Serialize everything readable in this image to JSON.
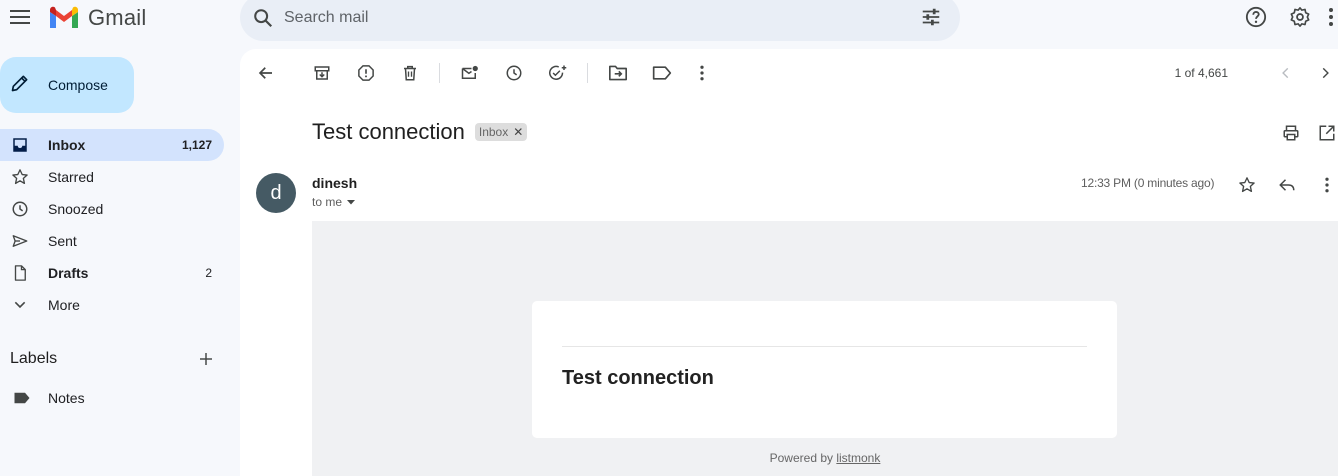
{
  "brand": {
    "name": "Gmail",
    "colors": {
      "red": "#ea4335",
      "blue": "#4285f4",
      "green": "#34a853",
      "yellow": "#fbbc04"
    }
  },
  "search": {
    "placeholder": "Search mail"
  },
  "sidebar": {
    "compose_label": "Compose",
    "items": [
      {
        "label": "Inbox",
        "count": "1,127",
        "icon": "inbox-icon",
        "active": true
      },
      {
        "label": "Starred",
        "count": "",
        "icon": "star-icon"
      },
      {
        "label": "Snoozed",
        "count": "",
        "icon": "clock-icon"
      },
      {
        "label": "Sent",
        "count": "",
        "icon": "send-icon"
      },
      {
        "label": "Drafts",
        "count": "2",
        "icon": "draft-icon"
      },
      {
        "label": "More",
        "count": "",
        "icon": "chevron-down-icon"
      }
    ],
    "labels_title": "Labels",
    "labels": [
      {
        "label": "Notes",
        "icon": "label-icon"
      }
    ]
  },
  "toolbar": {
    "pager": "1 of 4,661"
  },
  "message": {
    "subject": "Test connection",
    "chip": "Inbox",
    "sender": "dinesh",
    "avatar_letter": "d",
    "recipient": "to me",
    "timestamp": "12:33 PM (0 minutes ago)",
    "body_title": "Test connection",
    "footer_prefix": "Powered by",
    "footer_link": "listmonk"
  }
}
